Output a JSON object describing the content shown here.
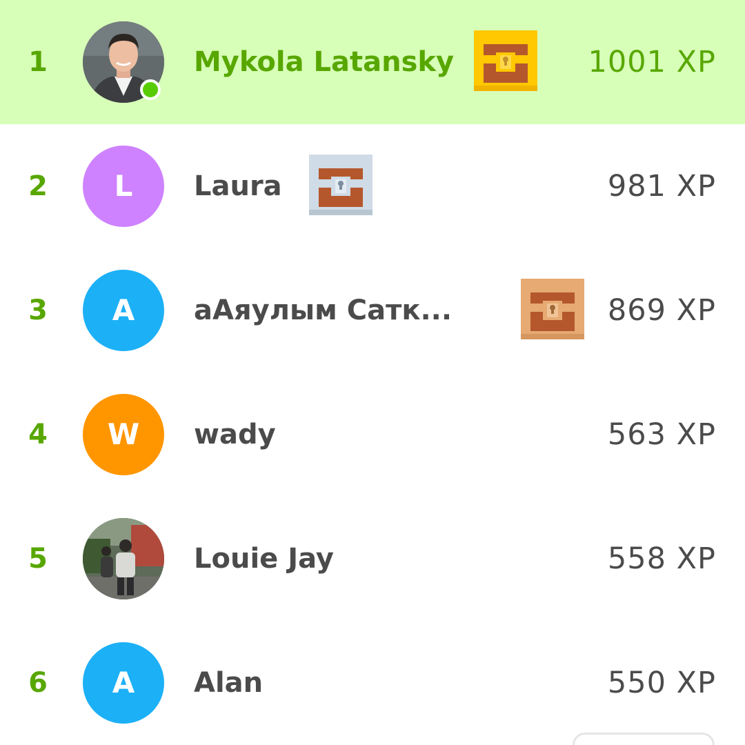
{
  "leaderboard": {
    "rows": [
      {
        "rank": "1",
        "name": "Mykola Latansky",
        "xp": "1001 XP",
        "avatar_initial": "",
        "avatar_type": "photo-man-in-suit",
        "online": true,
        "highlight": true,
        "chest": "gold-chest-icon"
      },
      {
        "rank": "2",
        "name": "Laura",
        "xp": "981 XP",
        "avatar_initial": "L",
        "avatar_color": "#ce82ff",
        "chest": "silver-chest-icon"
      },
      {
        "rank": "3",
        "name": "аАяулым Сатк...",
        "xp": "869 XP",
        "avatar_initial": "A",
        "avatar_color": "#1cb0f6",
        "chest": "bronze-chest-icon"
      },
      {
        "rank": "4",
        "name": "wady",
        "xp": "563 XP",
        "avatar_initial": "W",
        "avatar_color": "#ff9600"
      },
      {
        "rank": "5",
        "name": "Louie Jay",
        "xp": "558 XP",
        "avatar_initial": "",
        "avatar_type": "photo-person-outdoors"
      },
      {
        "rank": "6",
        "name": "Alan",
        "xp": "550 XP",
        "avatar_initial": "A",
        "avatar_color": "#1cb0f6"
      }
    ]
  },
  "colors": {
    "highlight_bg": "#d7ffb8",
    "rank_green": "#58a700",
    "online_green": "#58cc02",
    "text_dark": "#4b4b4b",
    "gold_chest": "#ffc800",
    "silver_chest": "#cfdbe6",
    "bronze_chest": "#e6aa72"
  }
}
